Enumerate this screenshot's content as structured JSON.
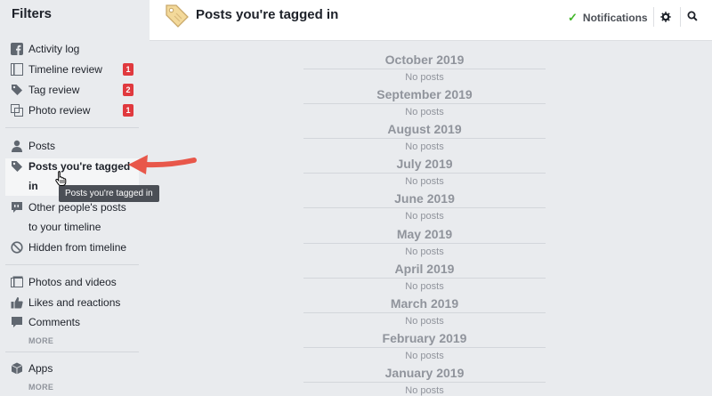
{
  "sidebar": {
    "title": "Filters",
    "items": [
      {
        "label": "Activity log",
        "icon": "facebook-icon"
      },
      {
        "label": "Timeline review",
        "icon": "timeline-icon",
        "badge": "1"
      },
      {
        "label": "Tag review",
        "icon": "tag-icon",
        "badge": "2"
      },
      {
        "label": "Photo review",
        "icon": "photo-icon",
        "badge": "1"
      },
      {
        "label": "Posts",
        "icon": "person-icon"
      },
      {
        "label_line1": "Posts you're tagged",
        "label_line2": "in",
        "icon": "tag-icon"
      },
      {
        "label_line1": "Other people's posts",
        "label_line2": "to your timeline",
        "icon": "comment-icon"
      },
      {
        "label": "Hidden from timeline",
        "icon": "hidden-icon"
      },
      {
        "label": "Photos and videos",
        "icon": "photos-icon"
      },
      {
        "label": "Likes and reactions",
        "icon": "like-icon"
      },
      {
        "label": "Comments",
        "icon": "comment-icon"
      },
      {
        "label": "Apps",
        "icon": "apps-icon"
      }
    ],
    "more_1": "MORE",
    "more_2": "MORE"
  },
  "tooltip": "Posts you're tagged in",
  "header": {
    "title": "Posts you're tagged in",
    "notifications": "Notifications"
  },
  "colors": {
    "badge": "#e0393e",
    "arrow": "#e8574a",
    "check": "#42b72a"
  },
  "timeline": [
    {
      "month": "October 2019",
      "status": "No posts"
    },
    {
      "month": "September 2019",
      "status": "No posts"
    },
    {
      "month": "August 2019",
      "status": "No posts"
    },
    {
      "month": "July 2019",
      "status": "No posts"
    },
    {
      "month": "June 2019",
      "status": "No posts"
    },
    {
      "month": "May 2019",
      "status": "No posts"
    },
    {
      "month": "April 2019",
      "status": "No posts"
    },
    {
      "month": "March 2019",
      "status": "No posts"
    },
    {
      "month": "February 2019",
      "status": "No posts"
    },
    {
      "month": "January 2019",
      "status": "No posts"
    }
  ]
}
